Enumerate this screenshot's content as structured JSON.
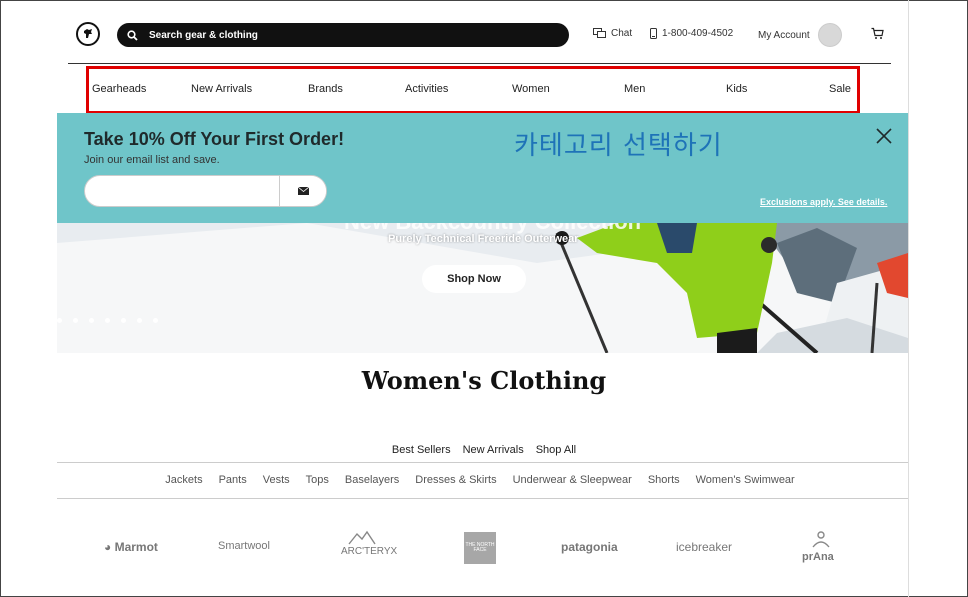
{
  "header": {
    "search_placeholder": "Search gear & clothing",
    "chat_label": "Chat",
    "phone_label": "1-800-409-4502",
    "account_label": "My Account"
  },
  "nav": {
    "categories": [
      "Gearheads",
      "New Arrivals",
      "Brands",
      "Activities",
      "Women",
      "Men",
      "Kids",
      "Sale"
    ]
  },
  "promo": {
    "title": "Take 10% Off Your First Order!",
    "subtitle": "Join our email list and save.",
    "exclusions": "Exclusions apply. See details.",
    "annotation": "카테고리 선택하기"
  },
  "hero": {
    "title": "New Backcountry Collection",
    "subtitle": "Purely Technical Freeride Outerwear",
    "cta": "Shop Now",
    "slide_count": 7
  },
  "page": {
    "title": "Women's Clothing",
    "subnav": [
      "Best Sellers",
      "New Arrivals",
      "Shop All"
    ],
    "categories": [
      "Jackets",
      "Pants",
      "Vests",
      "Tops",
      "Baselayers",
      "Dresses & Skirts",
      "Underwear & Sleepwear",
      "Shorts",
      "Women's Swimwear"
    ]
  },
  "brands": [
    "Marmot",
    "Smartwool",
    "ARC'TERYX",
    "THE NORTH FACE",
    "patagonia",
    "icebreaker",
    "prAna"
  ],
  "colors": {
    "promo_bg": "#6fc5c9",
    "highlight_border": "#e00000",
    "annotation_text": "#1e73b8"
  }
}
